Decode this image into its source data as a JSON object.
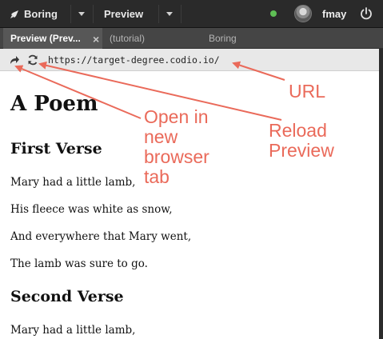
{
  "topbar": {
    "project_label": "Boring",
    "preview_label": "Preview",
    "username": "fmay",
    "status_color": "#5fbf55"
  },
  "tabs": [
    {
      "label": "Preview (Prev...",
      "active": true
    },
    {
      "label": "(tutorial)",
      "active": false
    },
    {
      "label": "Boring",
      "active": false
    }
  ],
  "tab_close_glyph": "×",
  "address": {
    "url": "https://target-degree.codio.io/",
    "open_icon": "share-forward-icon",
    "reload_icon": "reload-icon"
  },
  "content": {
    "title": "A Poem",
    "verses": [
      {
        "heading": "First Verse",
        "lines": [
          "Mary had a little lamb,",
          "His fleece was white as snow,",
          "And everywhere that Mary went,",
          "The lamb was sure to go."
        ]
      },
      {
        "heading": "Second Verse",
        "lines": [
          "Mary had a little lamb,"
        ]
      }
    ]
  },
  "annotations": {
    "url": "URL",
    "reload": "Reload\nPreview",
    "open": "Open in\nnew\nbrowser\ntab",
    "color": "#ea6a5a"
  }
}
